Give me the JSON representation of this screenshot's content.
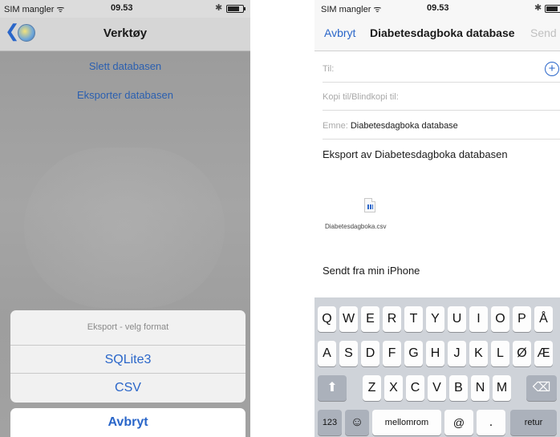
{
  "left": {
    "status": {
      "carrier": "SIM mangler ᯤ",
      "time": "09.53",
      "bluetooth": "✱"
    },
    "nav": {
      "back_glyph": "❮",
      "title": "Verktøy"
    },
    "links": [
      "Slett databasen",
      "Eksporter databasen"
    ],
    "sheet": {
      "title": "Eksport - velg format",
      "options": [
        "SQLite3",
        "CSV"
      ],
      "cancel": "Avbryt"
    }
  },
  "right": {
    "status": {
      "carrier": "SIM mangler ᯤ",
      "time": "09.53",
      "bluetooth": "✱"
    },
    "nav": {
      "cancel": "Avbryt",
      "title": "Diabetesdagboka database",
      "send": "Send"
    },
    "fields": {
      "to_label": "Til:",
      "cc_label": "Kopi til/Blindkopi til:",
      "subject_label": "Emne:",
      "subject_value": "Diabetesdagboka database"
    },
    "add_glyph": "+",
    "body": {
      "line1": "Eksport av Diabetesdagboka databasen",
      "attachment_name": "Diabetesdagboka.csv",
      "signature": "Sendt fra min iPhone"
    },
    "keyboard": {
      "row1": [
        "Q",
        "W",
        "E",
        "R",
        "T",
        "Y",
        "U",
        "I",
        "O",
        "P",
        "Å"
      ],
      "row2": [
        "A",
        "S",
        "D",
        "F",
        "G",
        "H",
        "J",
        "K",
        "L",
        "Ø",
        "Æ"
      ],
      "row3": [
        "Z",
        "X",
        "C",
        "V",
        "B",
        "N",
        "M"
      ],
      "shift_glyph": "⬆",
      "delete_glyph": "⌫",
      "num_key": "123",
      "emoji_glyph": "☺",
      "space": "mellomrom",
      "at": "@",
      "dot": ".",
      "return": "retur"
    }
  }
}
